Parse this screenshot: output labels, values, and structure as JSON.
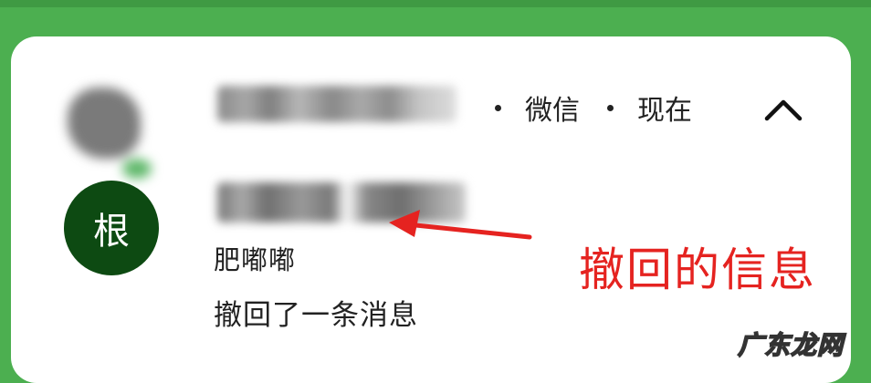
{
  "notification": {
    "app_name": "微信",
    "time": "现在",
    "avatar_char": "根",
    "sender_nickname": "肥嘟嘟",
    "message": "撤回了一条消息"
  },
  "annotation": {
    "label": "撤回的信息",
    "color": "#e52320"
  },
  "watermark": "广东龙网",
  "colors": {
    "background_green": "#4caf50",
    "avatar_bg": "#0d4a12",
    "card_bg": "#ffffff"
  },
  "icons": [
    "app-icon",
    "chevron-up-icon",
    "arrow-icon"
  ]
}
